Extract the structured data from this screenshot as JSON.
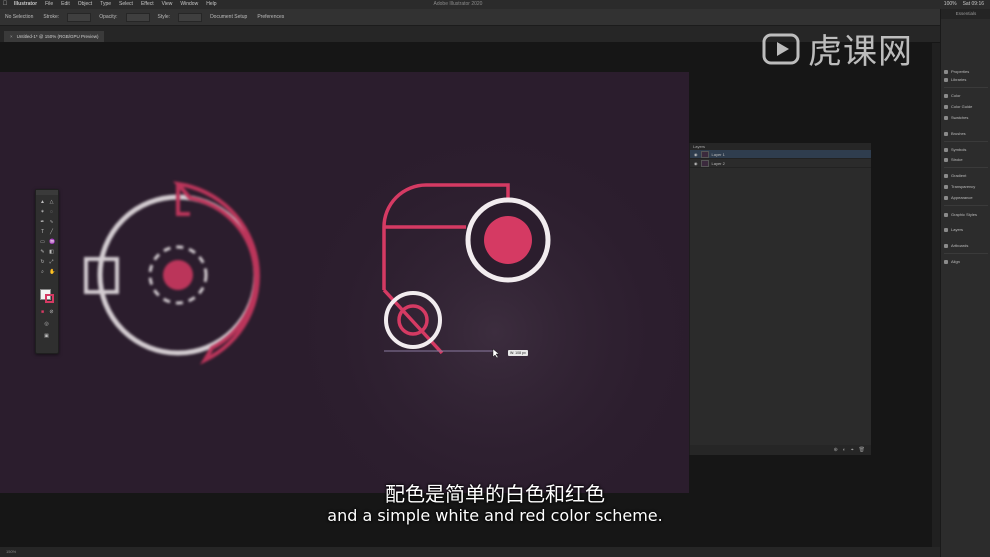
{
  "menubar": {
    "app_name": "Illustrator",
    "items": [
      "File",
      "Edit",
      "Object",
      "Type",
      "Select",
      "Effect",
      "View",
      "Window",
      "Help"
    ],
    "window_title": "Adobe Illustrator 2020",
    "right_items": [
      "100%",
      "Sat 09:16"
    ]
  },
  "controlbar": {
    "selection_label": "No Selection",
    "stroke_label": "Stroke:",
    "opacity_label": "Opacity:",
    "style_label": "Style:",
    "document_setup": "Document Setup",
    "preferences": "Preferences"
  },
  "tab": {
    "title": "Untitled-1* @ 150% (RGB/GPU Preview)"
  },
  "layers": {
    "header": "Layers",
    "rows": [
      {
        "name": "Layer 1",
        "selected": true
      },
      {
        "name": "Layer 2",
        "selected": false
      }
    ]
  },
  "dock": {
    "title": "Essentials",
    "items": [
      "Properties",
      "Libraries",
      "Color",
      "Color Guide",
      "Swatches",
      "Brushes",
      "Symbols",
      "Stroke",
      "Gradient",
      "Transparency",
      "Appearance",
      "Graphic Styles",
      "Layers",
      "Artboards",
      "Align"
    ]
  },
  "measure_tag": "W: 108 px",
  "watermark": {
    "text": "虎课网",
    "icon": "play-icon"
  },
  "subtitles": {
    "chinese": "配色是简单的白色和红色",
    "english": "and a simple white and red color scheme."
  },
  "statusbar": {
    "zoom": "150%"
  },
  "colors": {
    "artboard": "#2b1d2d",
    "accent_red": "#d53a63",
    "shape_white": "#f2ecef"
  }
}
